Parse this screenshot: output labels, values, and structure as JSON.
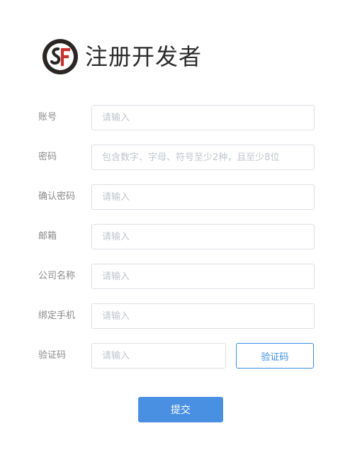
{
  "header": {
    "logo_text": "SF",
    "title": "注册开发者"
  },
  "form": {
    "fields": [
      {
        "label": "账号",
        "placeholder": "请输入",
        "value": ""
      },
      {
        "label": "密码",
        "placeholder": "包含数字、字母、符号至少2种，且至少8位",
        "value": ""
      },
      {
        "label": "确认密码",
        "placeholder": "请输入",
        "value": ""
      },
      {
        "label": "邮箱",
        "placeholder": "请输入",
        "value": ""
      },
      {
        "label": "公司名称",
        "placeholder": "请输入",
        "value": ""
      },
      {
        "label": "绑定手机",
        "placeholder": "请输入",
        "value": ""
      },
      {
        "label": "验证码",
        "placeholder": "请输入",
        "value": ""
      }
    ],
    "verify_button_label": "验证码",
    "submit_label": "提交"
  },
  "colors": {
    "accent": "#4a90e2",
    "accent_border": "#3a8ee6",
    "label": "#8a8a8a",
    "input_border": "#dcdfe6",
    "placeholder": "#c0c4cc",
    "logo_dark": "#2b2624",
    "logo_red": "#c8312b"
  }
}
